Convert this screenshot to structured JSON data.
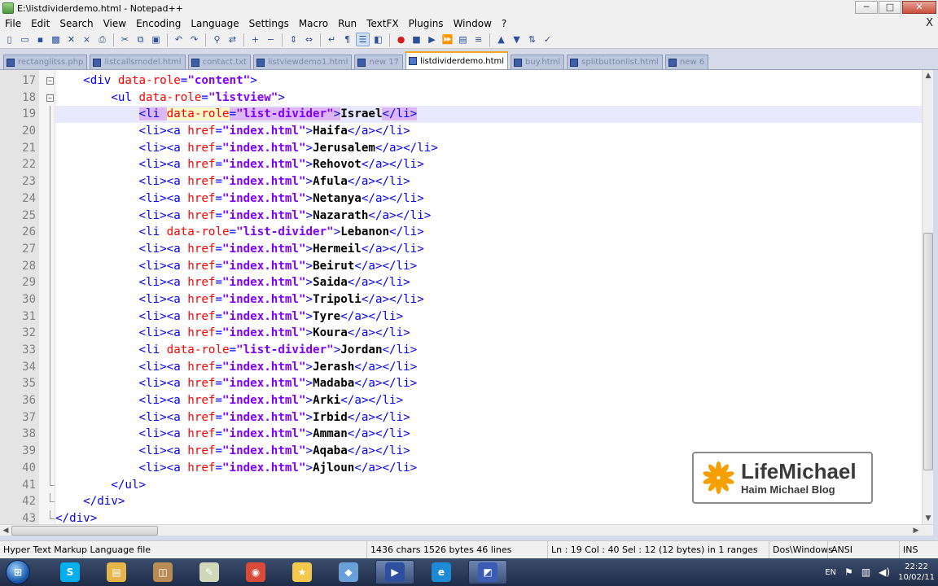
{
  "window": {
    "title": "E:\\listdividerdemo.html - Notepad++",
    "controls": [
      "─",
      "□",
      "✕"
    ],
    "doc_close": "X"
  },
  "menu": [
    "File",
    "Edit",
    "Search",
    "View",
    "Encoding",
    "Language",
    "Settings",
    "Macro",
    "Run",
    "TextFX",
    "Plugins",
    "Window",
    "?"
  ],
  "toolbar": {
    "icons": [
      "new-icon",
      "open-icon",
      "save-icon",
      "save-all-icon",
      "close-icon",
      "close-all-icon",
      "print-icon",
      "cut-icon",
      "copy-icon",
      "paste-icon",
      "undo-icon",
      "redo-icon",
      "find-icon",
      "replace-icon",
      "zoom-in-icon",
      "zoom-out-icon",
      "sync-v-icon",
      "sync-h-icon",
      "word-wrap-icon",
      "show-all-icon",
      "indent-guide-icon",
      "user-lang-icon",
      "record-icon",
      "stop-icon",
      "play-icon",
      "play-multi-icon",
      "save-macro-icon",
      "trim-icon",
      "up-icon",
      "down-icon",
      "sort-icon",
      "spell-icon"
    ]
  },
  "tabs": [
    {
      "label": "rectanglitss.php",
      "active": false
    },
    {
      "label": "listcallsmodel.html",
      "active": false
    },
    {
      "label": "contact.txt",
      "active": false
    },
    {
      "label": "listviewdemo1.html",
      "active": false
    },
    {
      "label": "new 17",
      "active": false
    },
    {
      "label": "listdividerdemo.html",
      "active": true
    },
    {
      "label": "buy.html",
      "active": false
    },
    {
      "label": "splitbuttonlist.html",
      "active": false
    },
    {
      "label": "new 6",
      "active": false
    }
  ],
  "editor": {
    "lines": [
      {
        "n": "17",
        "indent": "    ",
        "parts": [
          [
            "tag",
            "<div "
          ],
          [
            "attr",
            "data-role"
          ],
          [
            "tag",
            "="
          ],
          [
            "val",
            "\"content\""
          ],
          [
            "tag",
            ">"
          ]
        ],
        "fold": "box"
      },
      {
        "n": "18",
        "indent": "        ",
        "parts": [
          [
            "tag",
            "<ul "
          ],
          [
            "attr",
            "data-role"
          ],
          [
            "tag",
            "="
          ],
          [
            "val",
            "\"listview\""
          ],
          [
            "tag",
            ">"
          ]
        ],
        "fold": "box"
      },
      {
        "n": "19",
        "indent": "            ",
        "parts": [
          [
            "tag hl",
            "<li "
          ],
          [
            "attr hl-y",
            "data-role"
          ],
          [
            "tag hl",
            "="
          ],
          [
            "val hl",
            "\"list-divider\""
          ],
          [
            "tag hl",
            ">"
          ],
          [
            "txt",
            "Israel"
          ],
          [
            "tag hl",
            "</li>"
          ]
        ],
        "fold": "line",
        "current": true
      },
      {
        "n": "20",
        "indent": "            ",
        "parts": [
          [
            "tag",
            "<li><a "
          ],
          [
            "attr",
            "href"
          ],
          [
            "tag",
            "="
          ],
          [
            "val",
            "\"index.html\""
          ],
          [
            "tag",
            ">"
          ],
          [
            "txt",
            "Haifa"
          ],
          [
            "tag",
            "</a></li>"
          ]
        ],
        "fold": "line"
      },
      {
        "n": "21",
        "indent": "            ",
        "parts": [
          [
            "tag",
            "<li><a "
          ],
          [
            "attr",
            "href"
          ],
          [
            "tag",
            "="
          ],
          [
            "val",
            "\"index.html\""
          ],
          [
            "tag",
            ">"
          ],
          [
            "txt",
            "Jerusalem"
          ],
          [
            "tag",
            "</a></li>"
          ]
        ],
        "fold": "line"
      },
      {
        "n": "22",
        "indent": "            ",
        "parts": [
          [
            "tag",
            "<li><a "
          ],
          [
            "attr",
            "href"
          ],
          [
            "tag",
            "="
          ],
          [
            "val",
            "\"index.html\""
          ],
          [
            "tag",
            ">"
          ],
          [
            "txt",
            "Rehovot"
          ],
          [
            "tag",
            "</a></li>"
          ]
        ],
        "fold": "line"
      },
      {
        "n": "23",
        "indent": "            ",
        "parts": [
          [
            "tag",
            "<li><a "
          ],
          [
            "attr",
            "href"
          ],
          [
            "tag",
            "="
          ],
          [
            "val",
            "\"index.html\""
          ],
          [
            "tag",
            ">"
          ],
          [
            "txt",
            "Afula"
          ],
          [
            "tag",
            "</a></li>"
          ]
        ],
        "fold": "line"
      },
      {
        "n": "24",
        "indent": "            ",
        "parts": [
          [
            "tag",
            "<li><a "
          ],
          [
            "attr",
            "href"
          ],
          [
            "tag",
            "="
          ],
          [
            "val",
            "\"index.html\""
          ],
          [
            "tag",
            ">"
          ],
          [
            "txt",
            "Netanya"
          ],
          [
            "tag",
            "</a></li>"
          ]
        ],
        "fold": "line"
      },
      {
        "n": "25",
        "indent": "            ",
        "parts": [
          [
            "tag",
            "<li><a "
          ],
          [
            "attr",
            "href"
          ],
          [
            "tag",
            "="
          ],
          [
            "val",
            "\"index.html\""
          ],
          [
            "tag",
            ">"
          ],
          [
            "txt",
            "Nazarath"
          ],
          [
            "tag",
            "</a></li>"
          ]
        ],
        "fold": "line"
      },
      {
        "n": "26",
        "indent": "            ",
        "parts": [
          [
            "tag",
            "<li "
          ],
          [
            "attr",
            "data-role"
          ],
          [
            "tag",
            "="
          ],
          [
            "val",
            "\"list-divider\""
          ],
          [
            "tag",
            ">"
          ],
          [
            "txt",
            "Lebanon"
          ],
          [
            "tag",
            "</li>"
          ]
        ],
        "fold": "line"
      },
      {
        "n": "27",
        "indent": "            ",
        "parts": [
          [
            "tag",
            "<li><a "
          ],
          [
            "attr",
            "href"
          ],
          [
            "tag",
            "="
          ],
          [
            "val",
            "\"index.html\""
          ],
          [
            "tag",
            ">"
          ],
          [
            "txt",
            "Hermeil"
          ],
          [
            "tag",
            "</a></li>"
          ]
        ],
        "fold": "line"
      },
      {
        "n": "28",
        "indent": "            ",
        "parts": [
          [
            "tag",
            "<li><a "
          ],
          [
            "attr",
            "href"
          ],
          [
            "tag",
            "="
          ],
          [
            "val",
            "\"index.html\""
          ],
          [
            "tag",
            ">"
          ],
          [
            "txt",
            "Beirut"
          ],
          [
            "tag",
            "</a></li>"
          ]
        ],
        "fold": "line"
      },
      {
        "n": "29",
        "indent": "            ",
        "parts": [
          [
            "tag",
            "<li><a "
          ],
          [
            "attr",
            "href"
          ],
          [
            "tag",
            "="
          ],
          [
            "val",
            "\"index.html\""
          ],
          [
            "tag",
            ">"
          ],
          [
            "txt",
            "Saida"
          ],
          [
            "tag",
            "</a></li>"
          ]
        ],
        "fold": "line"
      },
      {
        "n": "30",
        "indent": "            ",
        "parts": [
          [
            "tag",
            "<li><a "
          ],
          [
            "attr",
            "href"
          ],
          [
            "tag",
            "="
          ],
          [
            "val",
            "\"index.html\""
          ],
          [
            "tag",
            ">"
          ],
          [
            "txt",
            "Tripoli"
          ],
          [
            "tag",
            "</a></li>"
          ]
        ],
        "fold": "line"
      },
      {
        "n": "31",
        "indent": "            ",
        "parts": [
          [
            "tag",
            "<li><a "
          ],
          [
            "attr",
            "href"
          ],
          [
            "tag",
            "="
          ],
          [
            "val",
            "\"index.html\""
          ],
          [
            "tag",
            ">"
          ],
          [
            "txt",
            "Tyre"
          ],
          [
            "tag",
            "</a></li>"
          ]
        ],
        "fold": "line"
      },
      {
        "n": "32",
        "indent": "            ",
        "parts": [
          [
            "tag",
            "<li><a "
          ],
          [
            "attr",
            "href"
          ],
          [
            "tag",
            "="
          ],
          [
            "val",
            "\"index.html\""
          ],
          [
            "tag",
            ">"
          ],
          [
            "txt",
            "Koura"
          ],
          [
            "tag",
            "</a></li>"
          ]
        ],
        "fold": "line"
      },
      {
        "n": "33",
        "indent": "            ",
        "parts": [
          [
            "tag",
            "<li "
          ],
          [
            "attr",
            "data-role"
          ],
          [
            "tag",
            "="
          ],
          [
            "val",
            "\"list-divider\""
          ],
          [
            "tag",
            ">"
          ],
          [
            "txt",
            "Jordan"
          ],
          [
            "tag",
            "</li>"
          ]
        ],
        "fold": "line"
      },
      {
        "n": "34",
        "indent": "            ",
        "parts": [
          [
            "tag",
            "<li><a "
          ],
          [
            "attr",
            "href"
          ],
          [
            "tag",
            "="
          ],
          [
            "val",
            "\"index.html\""
          ],
          [
            "tag",
            ">"
          ],
          [
            "txt",
            "Jerash"
          ],
          [
            "tag",
            "</a></li>"
          ]
        ],
        "fold": "line"
      },
      {
        "n": "35",
        "indent": "            ",
        "parts": [
          [
            "tag",
            "<li><a "
          ],
          [
            "attr",
            "href"
          ],
          [
            "tag",
            "="
          ],
          [
            "val",
            "\"index.html\""
          ],
          [
            "tag",
            ">"
          ],
          [
            "txt",
            "Madaba"
          ],
          [
            "tag",
            "</a></li>"
          ]
        ],
        "fold": "line"
      },
      {
        "n": "36",
        "indent": "            ",
        "parts": [
          [
            "tag",
            "<li><a "
          ],
          [
            "attr",
            "href"
          ],
          [
            "tag",
            "="
          ],
          [
            "val",
            "\"index.html\""
          ],
          [
            "tag",
            ">"
          ],
          [
            "txt",
            "Arki"
          ],
          [
            "tag",
            "</a></li>"
          ]
        ],
        "fold": "line"
      },
      {
        "n": "37",
        "indent": "            ",
        "parts": [
          [
            "tag",
            "<li><a "
          ],
          [
            "attr",
            "href"
          ],
          [
            "tag",
            "="
          ],
          [
            "val",
            "\"index.html\""
          ],
          [
            "tag",
            ">"
          ],
          [
            "txt",
            "Irbid"
          ],
          [
            "tag",
            "</a></li>"
          ]
        ],
        "fold": "line"
      },
      {
        "n": "38",
        "indent": "            ",
        "parts": [
          [
            "tag",
            "<li><a "
          ],
          [
            "attr",
            "href"
          ],
          [
            "tag",
            "="
          ],
          [
            "val",
            "\"index.html\""
          ],
          [
            "tag",
            ">"
          ],
          [
            "txt",
            "Amman"
          ],
          [
            "tag",
            "</a></li>"
          ]
        ],
        "fold": "line"
      },
      {
        "n": "39",
        "indent": "            ",
        "parts": [
          [
            "tag",
            "<li><a "
          ],
          [
            "attr",
            "href"
          ],
          [
            "tag",
            "="
          ],
          [
            "val",
            "\"index.html\""
          ],
          [
            "tag",
            ">"
          ],
          [
            "txt",
            "Aqaba"
          ],
          [
            "tag",
            "</a></li>"
          ]
        ],
        "fold": "line"
      },
      {
        "n": "40",
        "indent": "            ",
        "parts": [
          [
            "tag",
            "<li><a "
          ],
          [
            "attr",
            "href"
          ],
          [
            "tag",
            "="
          ],
          [
            "val",
            "\"index.html\""
          ],
          [
            "tag",
            ">"
          ],
          [
            "txt",
            "Ajloun"
          ],
          [
            "tag",
            "</a></li>"
          ]
        ],
        "fold": "line"
      },
      {
        "n": "41",
        "indent": "        ",
        "parts": [
          [
            "tag",
            "</ul>"
          ]
        ],
        "fold": "end"
      },
      {
        "n": "42",
        "indent": "    ",
        "parts": [
          [
            "tag",
            "</div>"
          ]
        ],
        "fold": "end"
      },
      {
        "n": "43",
        "indent": "",
        "parts": [
          [
            "tag",
            "</div>"
          ]
        ],
        "fold": "end"
      }
    ]
  },
  "statusbar": {
    "file_type": "Hyper Text Markup Language file",
    "length": "1436 chars   1526 bytes   46 lines",
    "position": "Ln : 19    Col : 40    Sel : 12 (12 bytes) in 1 ranges",
    "eol": "Dos\\Windows",
    "encoding": "ANSI",
    "mode": "INS"
  },
  "watermark": {
    "title": "LifeMichael",
    "subtitle": "Haim Michael Blog"
  },
  "taskbar": {
    "start_label": "⊞",
    "apps": [
      {
        "name": "skype-icon",
        "glyph": "S",
        "color": "#00aff0",
        "active": false
      },
      {
        "name": "explorer-icon",
        "glyph": "▤",
        "color": "#e6b54a",
        "active": false
      },
      {
        "name": "briefcase-icon",
        "glyph": "◫",
        "color": "#b98c55",
        "active": false
      },
      {
        "name": "notepad-icon",
        "glyph": "✎",
        "color": "#cfd8b8",
        "active": false
      },
      {
        "name": "chrome-icon",
        "glyph": "◉",
        "color": "#d94a38",
        "active": false
      },
      {
        "name": "jar-icon",
        "glyph": "★",
        "color": "#f2c94c",
        "active": false
      },
      {
        "name": "paint-icon",
        "glyph": "◆",
        "color": "#6aa0d8",
        "active": false
      },
      {
        "name": "screen-recorder-icon",
        "glyph": "▶",
        "color": "#2d4fa0",
        "active": true
      },
      {
        "name": "ie-icon",
        "glyph": "e",
        "color": "#1d8ad6",
        "active": false
      },
      {
        "name": "visual-studio-icon",
        "glyph": "◩",
        "color": "#3b5cb5",
        "active": true
      }
    ],
    "language": "EN",
    "time": "22:22",
    "date": "10/02/11"
  }
}
